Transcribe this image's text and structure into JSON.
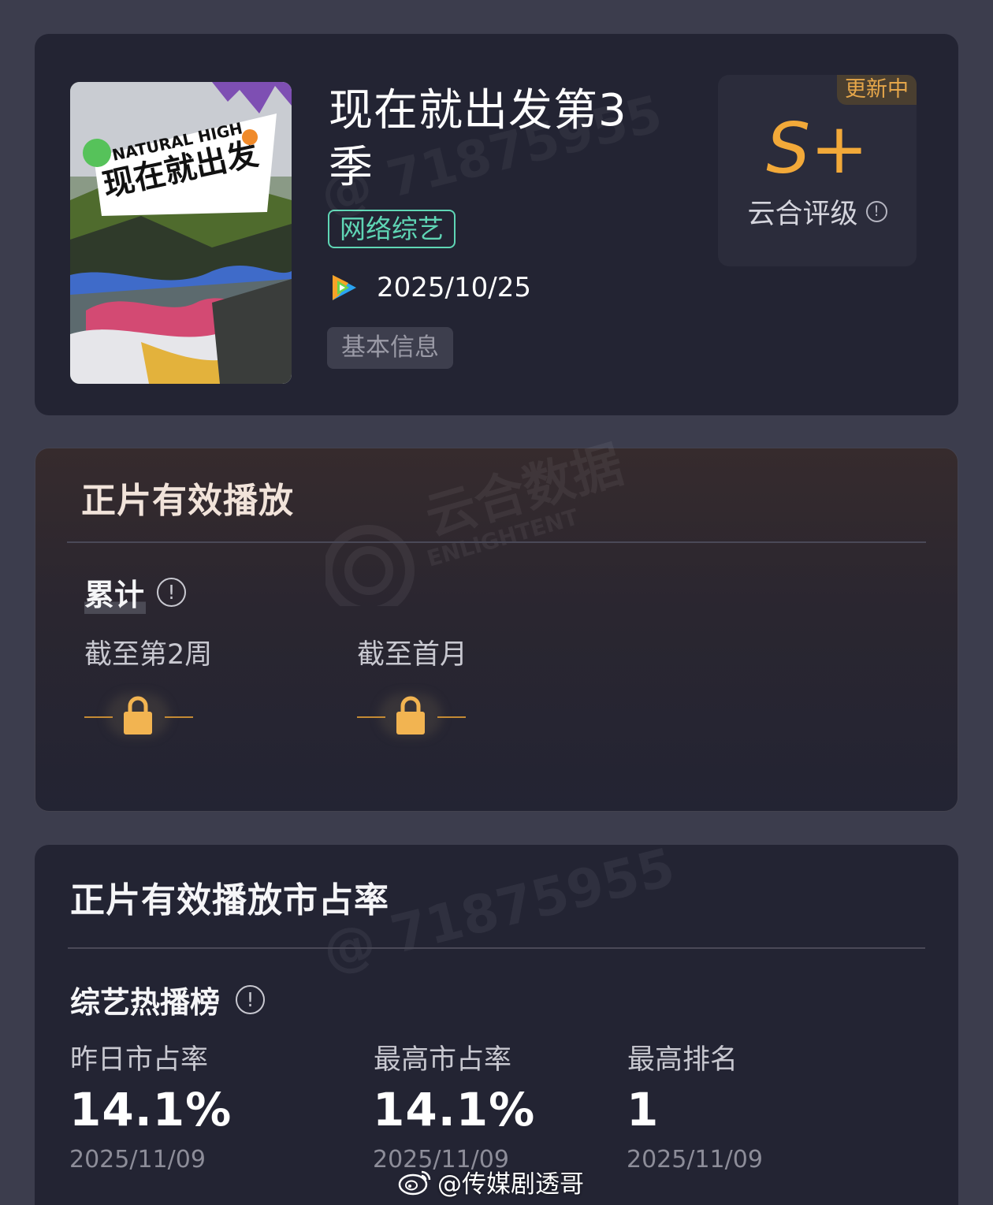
{
  "show": {
    "title": "现在就出发第3季",
    "genre": "网络综艺",
    "platform_icon": "tencent-video-icon",
    "release_date": "2025/10/25",
    "info_button": "基本信息",
    "poster_text": "NATURAL HIGH 现在就出发",
    "rating": {
      "badge": "更新中",
      "grade": "S+",
      "label": "云合评级"
    }
  },
  "play_section": {
    "title": "正片有效播放",
    "subtitle": "累计",
    "columns": [
      {
        "label": "截至第2周",
        "locked": true
      },
      {
        "label": "截至首月",
        "locked": true
      }
    ]
  },
  "share_section": {
    "title": "正片有效播放市占率",
    "subtitle": "综艺热播榜",
    "stats": [
      {
        "label": "昨日市占率",
        "value": "14.1%",
        "date": "2025/11/09"
      },
      {
        "label": "最高市占率",
        "value": "14.1%",
        "date": "2025/11/09"
      },
      {
        "label": "最高排名",
        "value": "1",
        "date": "2025/11/09"
      }
    ]
  },
  "watermarks": {
    "id_mark": "@ 71875955",
    "brand_cn": "云合数据",
    "brand_en": "ENLIGHTENT"
  },
  "footer": {
    "credit": "@传媒剧透哥"
  },
  "colors": {
    "background": "#3c3d4d",
    "card": "#232433",
    "accent_orange": "#f2a939",
    "genre_green": "#5fd6b5"
  }
}
